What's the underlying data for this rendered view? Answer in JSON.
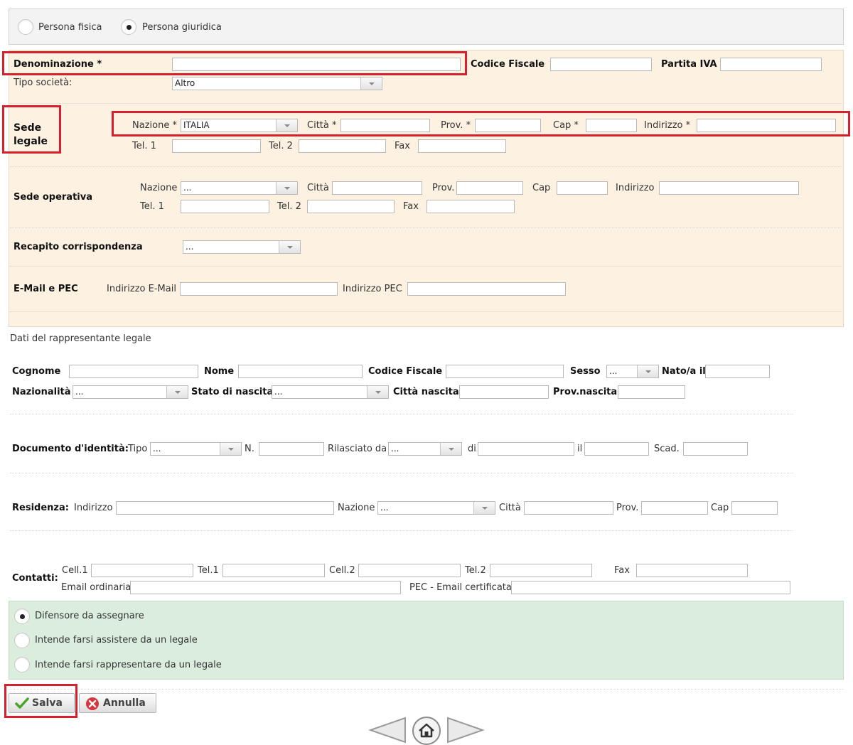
{
  "persona": {
    "fisica": "Persona fisica",
    "giuridica": "Persona giuridica"
  },
  "azienda": {
    "denominazione": "Denominazione *",
    "codice_fiscale": "Codice Fiscale",
    "partita_iva": "Partita IVA",
    "tipo_societa": "Tipo società:",
    "tipo_societa_value": "Altro"
  },
  "sede_legale": {
    "title_line1": "Sede",
    "title_line2": "legale",
    "nazione": "Nazione *",
    "nazione_value": "ITALIA",
    "citta": "Città *",
    "prov": "Prov. *",
    "cap": "Cap *",
    "indirizzo": "Indirizzo *",
    "tel1": "Tel. 1",
    "tel2": "Tel. 2",
    "fax": "Fax"
  },
  "sede_operativa": {
    "title": "Sede operativa",
    "nazione": "Nazione",
    "nazione_value": "...",
    "citta": "Città",
    "prov": "Prov.",
    "cap": "Cap",
    "indirizzo": "Indirizzo",
    "tel1": "Tel. 1",
    "tel2": "Tel. 2",
    "fax": "Fax"
  },
  "recapito": {
    "title": "Recapito corrispondenza",
    "value": "..."
  },
  "email": {
    "title": "E-Mail e PEC",
    "indirizzo_email": "Indirizzo E-Mail",
    "indirizzo_pec": "Indirizzo PEC"
  },
  "rappresentante": {
    "title": "Dati del rappresentante legale",
    "cognome": "Cognome",
    "nome": "Nome",
    "codice_fiscale": "Codice Fiscale",
    "sesso": "Sesso",
    "sesso_value": "...",
    "nato_il": "Nato/a il",
    "nazionalita": "Nazionalità",
    "nazionalita_value": "...",
    "stato_nascita": "Stato di nascita",
    "stato_nascita_value": "...",
    "citta_nascita": "Città nascita",
    "prov_nascita": "Prov.nascita"
  },
  "documento": {
    "title": "Documento d'identità:",
    "tipo": "Tipo",
    "tipo_value": "...",
    "n": "N.",
    "rilasciato_da": "Rilasciato da",
    "rilasciato_value": "...",
    "di": "di",
    "il": "il",
    "scad": "Scad."
  },
  "residenza": {
    "title": "Residenza:",
    "indirizzo": "Indirizzo",
    "nazione": "Nazione",
    "nazione_value": "...",
    "citta": "Città",
    "prov": "Prov.",
    "cap": "Cap"
  },
  "contatti": {
    "title": "Contatti:",
    "cell1": "Cell.1",
    "tel1": "Tel.1",
    "cell2": "Cell.2",
    "tel2": "Tel.2",
    "fax": "Fax",
    "email_ordinaria": "Email ordinaria",
    "pec": "PEC - Email certificata"
  },
  "difensore": {
    "opt1": "Difensore da assegnare",
    "opt2": "Intende farsi assistere da un legale",
    "opt3": "Intende farsi rappresentare da un legale"
  },
  "buttons": {
    "salva": "Salva",
    "annulla": "Annulla"
  },
  "colors": {
    "highlight": "#d6202c",
    "company_panel": "#fdf1e2",
    "defender_panel": "#dbeedd"
  }
}
